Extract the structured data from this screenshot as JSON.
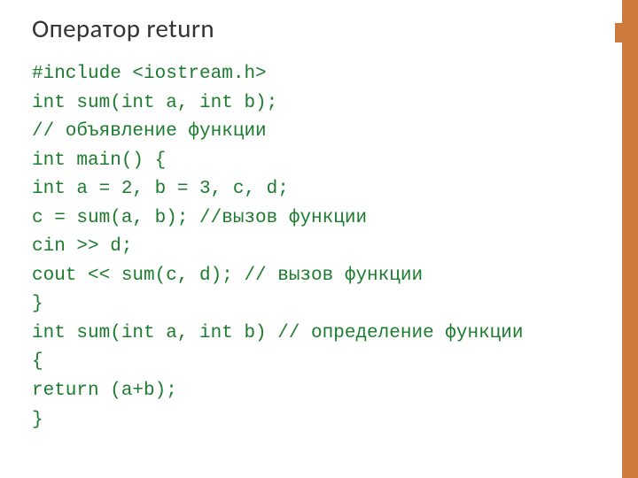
{
  "slide": {
    "title": "Оператор return",
    "code_lines": [
      "#include <iostream.h>",
      "int sum(int a, int b);",
      "// объявление функции",
      "int main() {",
      "int а = 2, b = 3, с, d;",
      "с = sum(a, b); //вызов функции",
      "cin >> d;",
      "cout << sum(c, d); // вызов функции",
      "}",
      "int sum(int a, int b) // определение функции",
      "{",
      "return (a+b);",
      "}"
    ]
  },
  "colors": {
    "accent": "#cd7a3e",
    "code": "#1c7c2e",
    "title": "#333333"
  }
}
